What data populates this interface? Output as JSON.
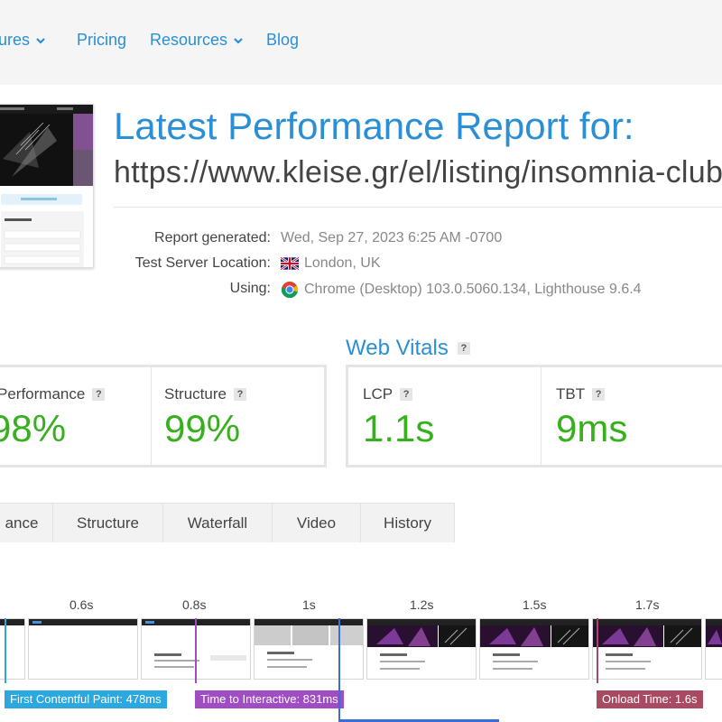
{
  "nav": {
    "features": "ures",
    "pricing": "Pricing",
    "resources": "Resources",
    "blog": "Blog"
  },
  "report": {
    "title": "Latest Performance Report for:",
    "url": "https://www.kleise.gr/el/listing/insomnia-club/",
    "generated_label": "Report generated:",
    "generated_value": "Wed, Sep 27, 2023 6:25 AM -0700",
    "location_label": "Test Server Location:",
    "location_value": "London, UK",
    "using_label": "Using:",
    "using_value": "Chrome (Desktop) 103.0.5060.134, Lighthouse 9.6.4"
  },
  "grades": {
    "performance_label": "Performance",
    "performance_value": "98%",
    "structure_label": "Structure",
    "structure_value": "99%"
  },
  "web_vitals": {
    "title": "Web Vitals",
    "lcp_label": "LCP",
    "lcp_value": "1.1s",
    "tbt_label": "TBT",
    "tbt_value": "9ms"
  },
  "tabs": [
    "ance",
    "Structure",
    "Waterfall",
    "Video",
    "History"
  ],
  "help_glyph": "?",
  "timeline": {
    "ticks": [
      "0.6s",
      "0.8s",
      "1s",
      "1.2s",
      "1.5s",
      "1.7s"
    ],
    "fcp": "First Contentful Paint: 478ms",
    "tti": "Time to Interactive: 831ms",
    "onload": "Onload Time: 1.6s"
  },
  "colors": {
    "accent": "#2a8fd4",
    "grade_green": "#37b01e",
    "fcp": "#2aa8df",
    "tti": "#a04dc4",
    "lcp": "#3a6ed6",
    "onload": "#a84a62"
  }
}
